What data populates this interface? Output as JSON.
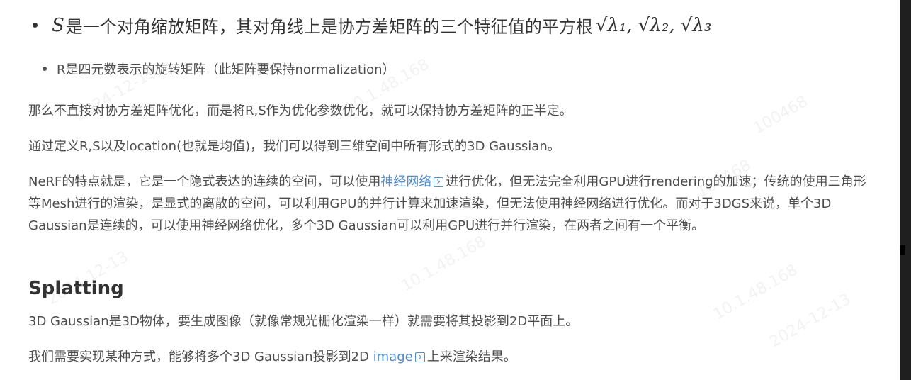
{
  "bullets": {
    "first": {
      "symbol": "S",
      "text": "是一个对角缩放矩阵，其对角线上是协方差矩阵的三个特征值的平方根",
      "math": "√λ₁, √λ₂, √λ₃"
    },
    "second": {
      "text": "R是四元数表示的旋转矩阵（此矩阵要保持normalization）"
    }
  },
  "paragraphs": {
    "p1": "那么不直接对协方差矩阵优化，而是将R,S作为优化参数优化，就可以保持协方差矩阵的正半定。",
    "p2": "通过定义R,S以及location(也就是均值)，我们可以得到三维空间中所有形式的3D Gaussian。",
    "p3": {
      "before_link": "NeRF的特点就是，它是一个隐式表达的连续的空间，可以使用",
      "link": "神经网络",
      "after_link": "进行优化，但无法完全利用GPU进行rendering的加速；传统的使用三角形等Mesh进行的渲染，是显式的离散的空间，可以利用GPU的并行计算来加速渲染，但无法使用神经网络进行优化。而对于3DGS来说，单个3D Gaussian是连续的，可以使用神经网络优化，多个3D Gaussian可以利用GPU进行并行渲染，在两者之间有一个平衡。"
    },
    "p4": "3D Gaussian是3D物体，要生成图像（就像常规光栅化渲染一样）就需要将其投影到2D平面上。",
    "p5": {
      "before_link": "我们需要实现某种方式，能够将多个3D Gaussian投影到2D ",
      "link": "image",
      "after_link": "上来渲染结果。"
    }
  },
  "heading": "Splatting",
  "watermarks": [
    "2024-12-13",
    "10.1.48.168",
    "100468",
    "2024-12-13",
    "10.1.48.168",
    "100468",
    "2024-12-13",
    "10.1.48.168"
  ],
  "colors": {
    "link": "#4f8fcf",
    "text": "#4d4d4d",
    "heading": "#333333"
  }
}
